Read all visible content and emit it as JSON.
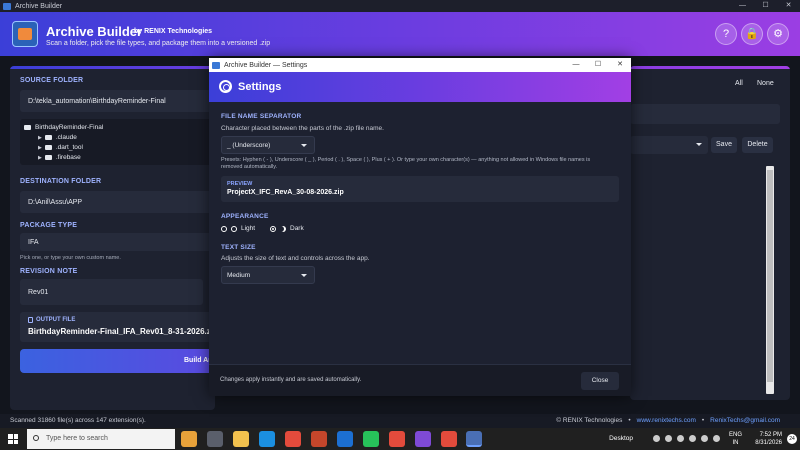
{
  "window": {
    "title": "Archive Builder",
    "minimize": "—",
    "maximize": "☐",
    "close": "✕"
  },
  "header": {
    "title": "Archive Builder",
    "by": "by RENIX Technologies",
    "subtitle": "Scan a folder, pick the file types, and package them into a versioned .zip",
    "help_icon": "?",
    "lock_icon": "🔒",
    "settings_icon": "⚙"
  },
  "left": {
    "source_label": "SOURCE FOLDER",
    "source_value": "D:\\tekla_automation\\BirthdayReminder-Final",
    "tree": [
      {
        "label": "BirthdayReminder-Final",
        "caret": "",
        "depth": 0
      },
      {
        "label": ".claude",
        "caret": "▶",
        "depth": 1
      },
      {
        "label": ".dart_tool",
        "caret": "▶",
        "depth": 1
      },
      {
        "label": ".firebase",
        "caret": "▶",
        "depth": 1
      }
    ],
    "dest_label": "DESTINATION FOLDER",
    "dest_value": "D:\\Anil\\Assu\\APP",
    "package_label": "PACKAGE TYPE",
    "package_value": "IFA",
    "package_hint": "Pick one, or type your own custom name.",
    "revision_label": "REVISION NOTE",
    "revision_value": "Rev01",
    "output_label": "OUTPUT FILE",
    "output_value": "BirthdayReminder-Final_IFA_Rev01_8-31-2026.zip",
    "build_label": "Build Ar"
  },
  "right": {
    "all_label": "All",
    "none_label": "None",
    "save_label": "Save",
    "delete_label": "Delete"
  },
  "dialog": {
    "window_title": "Archive Builder — Settings",
    "minimize": "—",
    "maximize": "☐",
    "close_x": "✕",
    "heading": "Settings",
    "sep_label": "FILE NAME SEPARATOR",
    "sep_desc": "Character placed between the parts of the .zip file name.",
    "sep_value": "_ (Underscore)",
    "sep_presets": "Presets: Hyphen ( - ), Underscore ( _ ), Period ( . ), Space ( ), Plus ( + ). Or type your own character(s) — anything not allowed in Windows file names is removed automatically.",
    "preview_label": "PREVIEW",
    "preview_value": "ProjectX_IFC_RevA_30-08-2026.zip",
    "appearance_label": "APPEARANCE",
    "light_label": "Light",
    "dark_label": "Dark",
    "appearance_selected": "Dark",
    "textsize_label": "TEXT SIZE",
    "textsize_desc": "Adjusts the size of text and controls across the app.",
    "textsize_value": "Medium",
    "footer_note": "Changes apply instantly and are saved automatically.",
    "close_label": "Close"
  },
  "status": {
    "scan_text": "Scanned 31860 file(s) across 147 extension(s).",
    "company": "© RENIX Technologies",
    "sep": "•",
    "website": "www.renixtechs.com",
    "email": "RenixTechs@gmail.com"
  },
  "taskbar": {
    "search_placeholder": "Type here to search",
    "desktop_label": "Desktop",
    "lang_line1": "ENG",
    "lang_line2": "IN",
    "time": "7:52 PM",
    "date": "8/31/2026",
    "notifications": "24",
    "colors": {
      "accent": "#6a3de0",
      "link": "#6ea0ff"
    }
  }
}
